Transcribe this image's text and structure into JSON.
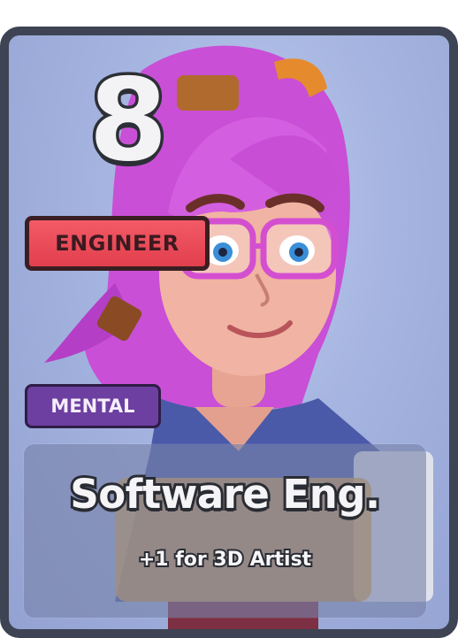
{
  "card": {
    "cost": "8",
    "class_label": "ENGINEER",
    "type_label": "MENTAL",
    "name": "Software Eng.",
    "effect": "+1 for 3D Artist",
    "portrait_icon": "character-portrait-icon"
  }
}
